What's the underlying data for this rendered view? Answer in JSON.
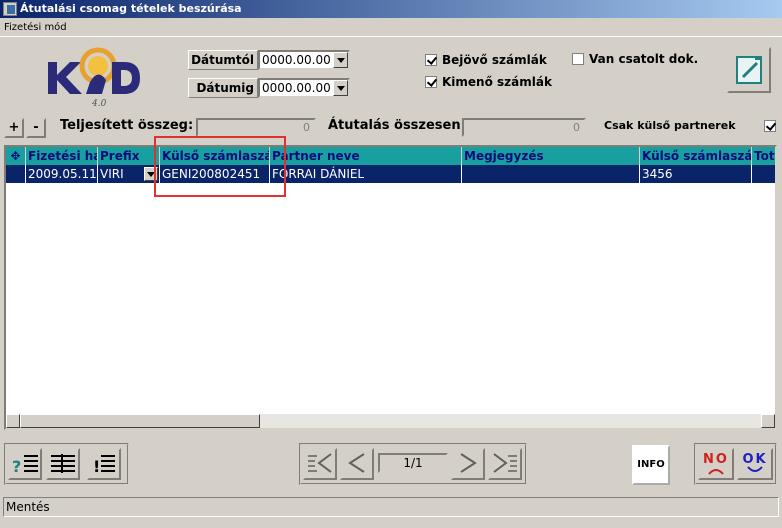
{
  "window": {
    "title": "Átutalási csomag tételek beszúrása"
  },
  "menu": {
    "items": [
      "Fizetési mód"
    ]
  },
  "logo": {
    "text": "K2D",
    "version": "4.0"
  },
  "filters": {
    "date_from_label": "Dátumtól",
    "date_from_value": "0000.00.00",
    "date_to_label": "Dátumig",
    "date_to_value": "0000.00.00",
    "incoming_label": "Bejövő számlák",
    "incoming_checked": true,
    "outgoing_label": "Kimenő számlák",
    "outgoing_checked": true,
    "attached_label": "Van csatolt dok.",
    "attached_checked": false,
    "external_label": "Csak külső partnerek",
    "external_checked": true
  },
  "summary": {
    "completed_label": "Teljesített összeg:",
    "completed_value": "0",
    "transfer_label": "Átutalás összesen:",
    "transfer_value": "0"
  },
  "grid": {
    "columns": [
      "Fizetési ha",
      "Prefix",
      "Külső számlaszá",
      "Partner neve",
      "Megjegyzés",
      "Külső számlaszán",
      "Tot"
    ],
    "rows": [
      {
        "date": "2009.05.11.",
        "prefix": "VIRI",
        "external_invoice": "GENI200802451",
        "partner": "FORRAI DÁNIEL",
        "note": "",
        "external_account": "3456",
        "total": ""
      }
    ]
  },
  "pager": {
    "page": "1/1"
  },
  "buttons": {
    "add": "+",
    "remove": "-",
    "info": "INFO",
    "no": "NO",
    "ok": "OK"
  },
  "status": {
    "text": "Mentés"
  },
  "colors": {
    "header_bg": "#18a0a0",
    "selected_row": "#0a246a",
    "highlight_box": "#e03030"
  }
}
